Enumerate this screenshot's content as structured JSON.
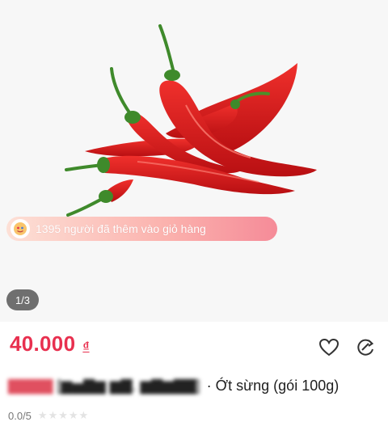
{
  "gallery": {
    "image_subject": "red-chili-peppers",
    "cart_banner_text": "1395 người đã thêm vào giỏ hàng",
    "image_counter": "1/3"
  },
  "product": {
    "price": "40.000",
    "currency": "₫",
    "seller_redacted_a": "▇▇▇▇",
    "seller_redacted_b": "[▆▅▇▆ ▆▇. ▆▇▆▇▇]",
    "name": "· Ớt sừng (gói 100g)",
    "rating": "0.0/5",
    "stars": "★★★★★"
  },
  "icons": [
    "heart-icon",
    "share-icon",
    "cart-avatar-icon"
  ],
  "colors": {
    "price": "#e8304f",
    "banner_start": "#fde0d6",
    "banner_end": "#f58b98",
    "counter_bg": "#6f6f6f"
  }
}
